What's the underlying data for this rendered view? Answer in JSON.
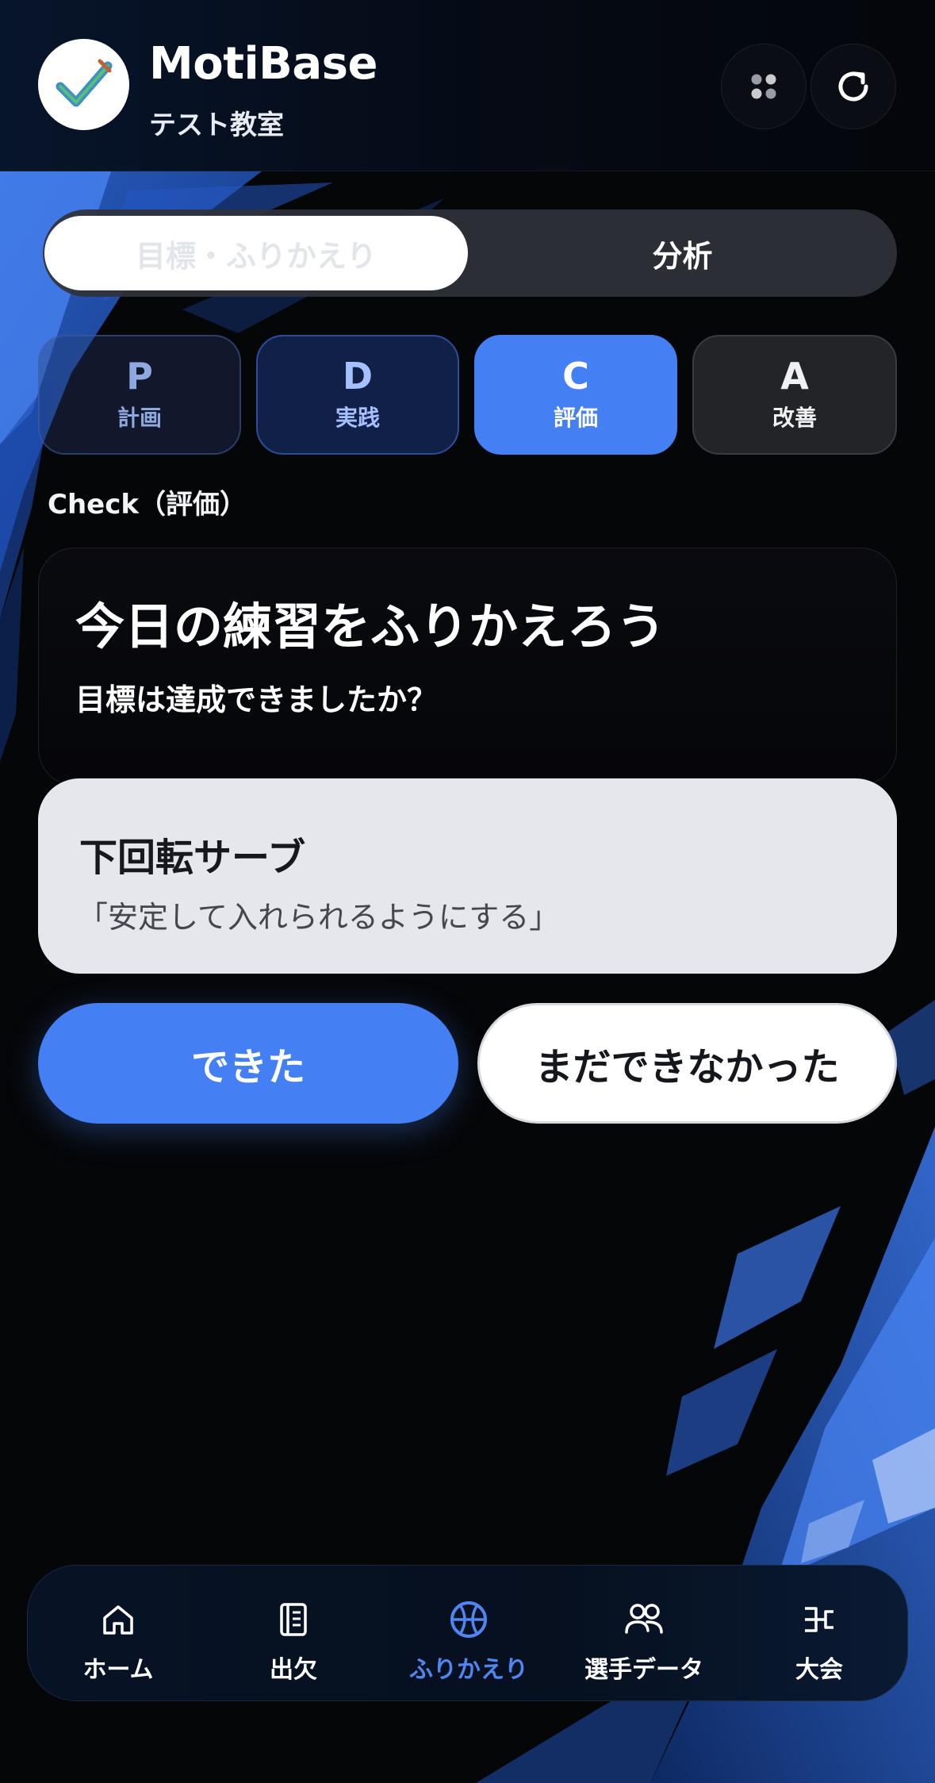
{
  "header": {
    "title": "MotiBase",
    "subtitle": "テスト教室",
    "logo_icon": "checkmark-logo-icon",
    "buttons": [
      {
        "icon": "apps-grid-icon"
      },
      {
        "icon": "refresh-icon"
      }
    ]
  },
  "segment": {
    "active_label": "目標・ふりかえり",
    "inactive_label": "分析"
  },
  "pdca": [
    {
      "letter": "P",
      "label": "計画",
      "state": "done"
    },
    {
      "letter": "D",
      "label": "実践",
      "state": "done"
    },
    {
      "letter": "C",
      "label": "評価",
      "state": "active"
    },
    {
      "letter": "A",
      "label": "改善",
      "state": "upcoming"
    }
  ],
  "section_label": "Check（評価）",
  "question": {
    "title": "今日の練習をふりかえろう",
    "subtitle": "目標は達成できましたか？"
  },
  "goal": {
    "title": "下回転サーブ",
    "description": "「安定して入れられるようにする」"
  },
  "answers": {
    "yes_label": "できた",
    "no_label": "まだできなかった"
  },
  "bottom_nav": [
    {
      "label": "ホーム",
      "icon": "home-icon",
      "active": false
    },
    {
      "label": "出欠",
      "icon": "notebook-icon",
      "active": false
    },
    {
      "label": "ふりかえり",
      "icon": "globe-icon",
      "active": true
    },
    {
      "label": "選手データ",
      "icon": "users-icon",
      "active": false
    },
    {
      "label": "大会",
      "icon": "bracket-icon",
      "active": false
    }
  ],
  "colors": {
    "accent": "#4480F4",
    "background": "#050608",
    "goal_card": "#E6E7EC"
  }
}
